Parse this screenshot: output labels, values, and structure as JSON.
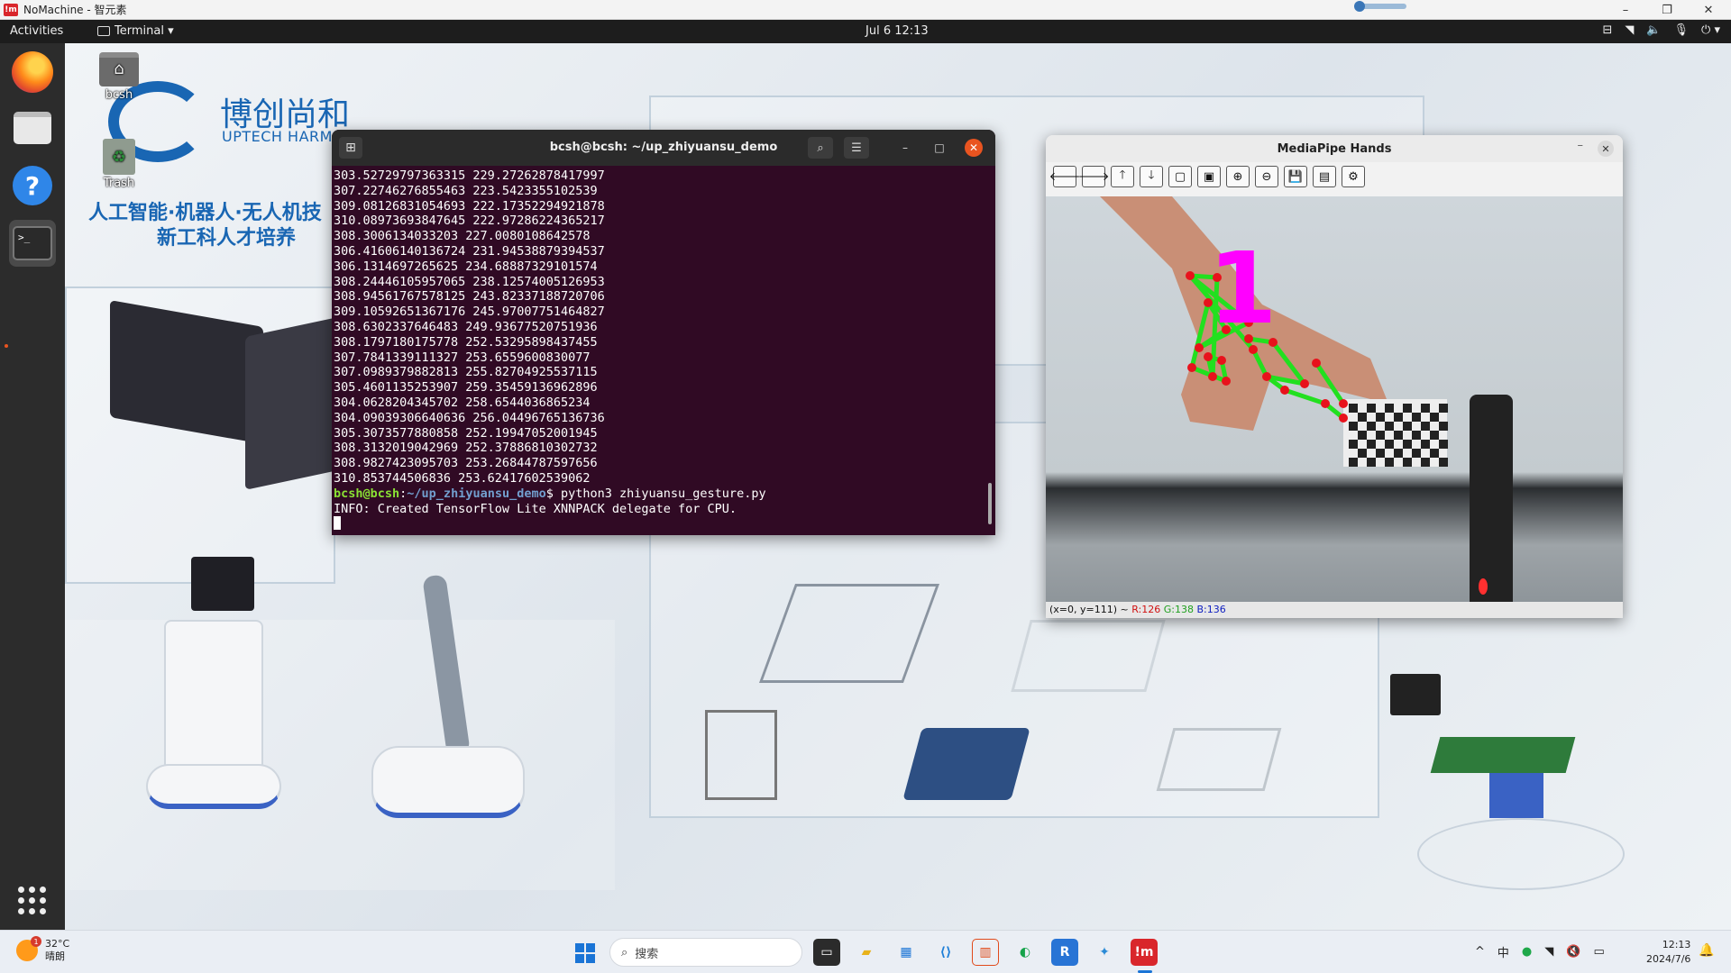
{
  "nomachine": {
    "title": "NoMachine - 智元素",
    "logo_text": "!m",
    "controls": {
      "minimize": "–",
      "restore": "❐",
      "close": "✕"
    }
  },
  "topbar": {
    "activities": "Activities",
    "app_menu": "Terminal ▾",
    "clock": "Jul 6  12:13",
    "tray_icons": [
      "network-wired-icon",
      "wifi-icon",
      "volume-icon",
      "mic-icon",
      "power-icon"
    ]
  },
  "dock": {
    "items": [
      "firefox-icon",
      "files-icon",
      "help-icon",
      "terminal-icon"
    ],
    "terminal_glyph": ">_"
  },
  "desktop": {
    "brand": {
      "cn_name": "博创尚和",
      "en_name": "UPTECH HARMONY",
      "tagline1": "人工智能·机器人·无人机技",
      "tagline2": "新工科人才培养"
    },
    "icons": [
      {
        "label": "bcsh",
        "type": "home"
      },
      {
        "label": "Trash",
        "type": "trash",
        "overlay": "obot"
      }
    ]
  },
  "terminal": {
    "title": "bcsh@bcsh: ~/up_zhiyuansu_demo",
    "lines": [
      "303.52729797363315 229.27262878417997",
      "307.22746276855463 223.5423355102539",
      "309.08126831054693 222.17352294921878",
      "310.08973693847645 222.97286224365217",
      "308.3006134033203 227.0080108642578",
      "306.41606140136724 231.94538879394537",
      "306.1314697265625 234.68887329101574",
      "308.24446105957065 238.12574005126953",
      "308.94561767578125 243.82337188720706",
      "309.10592651367176 245.97007751464827",
      "308.6302337646483 249.93677520751936",
      "308.1797180175778 252.53295898437455",
      "307.7841339111327 253.6559600830077",
      "307.0989379882813 255.82704925537115",
      "305.4601135253907 259.35459136962896",
      "304.0628204345702 258.6544036865234",
      "304.09039306640636 256.04496765136736",
      "305.3073577880858 252.19947052001945",
      "308.3132019042969 252.37886810302732",
      "308.9827423095703 253.26844787597656",
      "310.853744506836 253.62417602539062"
    ],
    "prompt_user": "bcsh@bcsh",
    "prompt_sep": ":",
    "prompt_path": "~/up_zhiyuansu_demo",
    "prompt_end": "$ ",
    "command": "python3 zhiyuansu_gesture.py",
    "info": "INFO: Created TensorFlow Lite XNNPACK delegate for CPU."
  },
  "mediapipe": {
    "title": "MediaPipe Hands",
    "toolbar": [
      "🡐",
      "🡒",
      "🡑",
      "🡓",
      "▢",
      "▣",
      "⊕",
      "⊖",
      "💾",
      "▤",
      "⚙"
    ],
    "status_prefix": "(x=0, y=111) ~ ",
    "status_r": "R:126",
    "status_g": "G:138",
    "status_b": "B:136",
    "gesture_label": "1",
    "landmark_color": "#e8121c",
    "connection_color": "#22e01f",
    "label_color": "#ff00ff"
  },
  "taskbar": {
    "weather_temp": "32°C",
    "weather_desc": "晴朗",
    "weather_badge": "1",
    "search_placeholder": "搜索",
    "ime": "中",
    "time": "12:13",
    "date": "2024/7/6"
  }
}
